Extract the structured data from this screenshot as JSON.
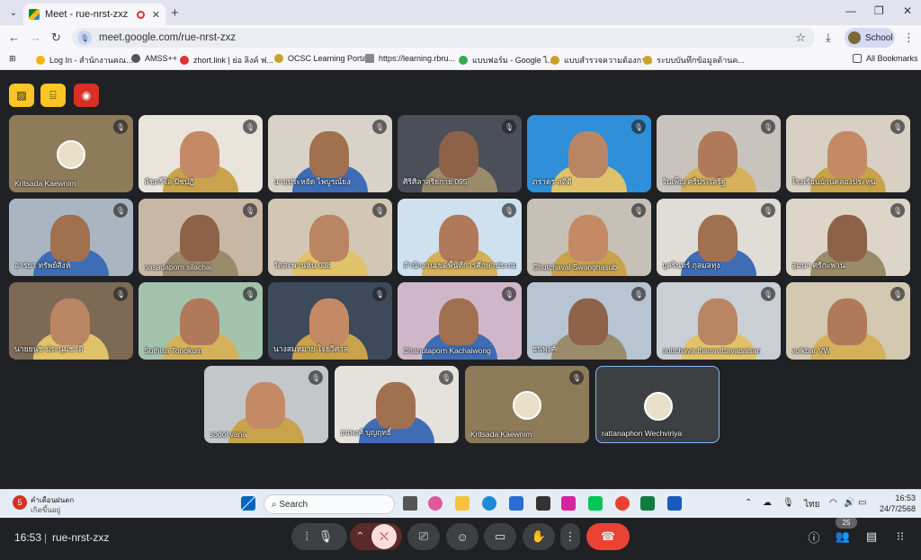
{
  "browser": {
    "tab_title": "Meet - rue-nrst-zxz",
    "url": "meet.google.com/rue-nrst-zxz",
    "profile_label": "School",
    "bookmarks": [
      {
        "label": "Log In - สำนักงานคณ..."
      },
      {
        "label": "AMSS++"
      },
      {
        "label": "zhort.link | ย่อ ลิงค์ ฟ..."
      },
      {
        "label": "OCSC Learning Portal"
      },
      {
        "label": "https://learning.rbru..."
      },
      {
        "label": "แบบฟอร์ม - Google ไ..."
      },
      {
        "label": "แบบสำรวจความต้องกา..."
      },
      {
        "label": "ระบบบันทึกข้อมูลด้านค..."
      }
    ],
    "all_bookmarks_label": "All Bookmarks"
  },
  "meet": {
    "participants": [
      {
        "name": "Kritsada Kaewnim",
        "avatar": true
      },
      {
        "name": "พัชตรีโล ปัชปฏิ"
      },
      {
        "name": "นายประหยัด ไพบูรณ์ยง"
      },
      {
        "name": "ศิริศิลาสุริยกาย 095"
      },
      {
        "name": "ภราดร สติดี"
      },
      {
        "name": "วันเพ็ญ ศรีประเสริฐ"
      },
      {
        "name": "โรงเรียนบ้านคลองประทุน"
      },
      {
        "name": "อารยา ทรัพย์สิงห์"
      },
      {
        "name": "nasadaporn silachai"
      },
      {
        "name": "วัดสะพานหิน 038"
      },
      {
        "name": "สำนักงานเขตพื้นที่การศึกษาประถม..."
      },
      {
        "name": "Chutchaval Swanghasub"
      },
      {
        "name": "บุศรินทร์ กุลมลทุง"
      },
      {
        "name": "สุมนา ศรีกะพาน"
      },
      {
        "name": "นายยนุช ประนุมชาติ"
      },
      {
        "name": "Suthisa Tongkum"
      },
      {
        "name": "นางสมหมาย ใจยวิศาล"
      },
      {
        "name": "Chanutaporn Kachaiwong"
      },
      {
        "name": "ธนพุงศ์"
      },
      {
        "name": "nuttchaya thanavittayapaisan"
      },
      {
        "name": "volkbar VW"
      },
      {
        "name": "sodol vana"
      },
      {
        "name": "ธนพงศ์ บุญฤทธิ์"
      },
      {
        "name": "Kritsada Kaewnim",
        "avatar": true
      },
      {
        "name": "rattanaphon Wechviriya",
        "avatar": true
      }
    ],
    "time": "16:53",
    "meeting_code": "rue-nrst-zxz",
    "participant_count": "25"
  },
  "taskbar": {
    "weather_title": "คำเตือนฝนตก",
    "weather_sub": "เกิดขึ้นอยู่",
    "weather_badge": "5",
    "search_placeholder": "Search",
    "lang": "ไทย",
    "clock_time": "16:53",
    "clock_date": "24/7/2568"
  },
  "colors": {
    "accent": "#8ab4f8",
    "end_call": "#ea4335",
    "chrome_bg": "#e3e3f0"
  }
}
